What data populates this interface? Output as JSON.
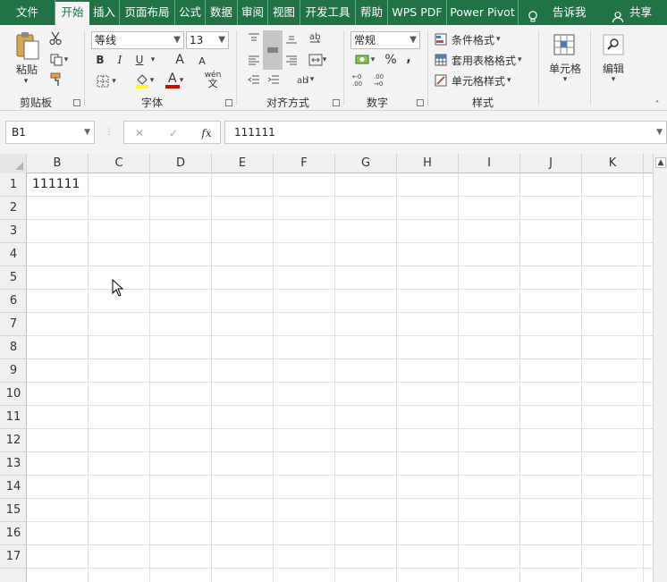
{
  "tabs": [
    "文件",
    "开始",
    "插入",
    "页面布局",
    "公式",
    "数据",
    "审阅",
    "视图",
    "开发工具",
    "帮助",
    "WPS PDF",
    "Power Pivot"
  ],
  "tell_me": "告诉我",
  "share": "共享",
  "ribbon": {
    "clipboard": {
      "paste": "粘贴",
      "group": "剪贴板"
    },
    "font": {
      "name": "等线",
      "size": "13",
      "group": "字体",
      "bold": "B",
      "italic": "I",
      "underline": "U",
      "grow": "A",
      "shrink": "A",
      "color_a": "A",
      "phonetic": "wén"
    },
    "align": {
      "group": "对齐方式"
    },
    "number": {
      "format": "常规",
      "percent": "%",
      "comma": ",",
      "group": "数字"
    },
    "styles": {
      "cond": "条件格式",
      "table": "套用表格格式",
      "cell": "单元格样式",
      "group": "样式"
    },
    "cells": {
      "label": "单元格"
    },
    "edit": {
      "label": "编辑"
    }
  },
  "formula_bar": {
    "name_box": "B1",
    "cancel": "✕",
    "enter": "✓",
    "fx": "fx",
    "content": "111111"
  },
  "grid": {
    "columns": [
      "B",
      "C",
      "D",
      "E",
      "F",
      "G",
      "H",
      "I",
      "J",
      "K"
    ],
    "rows": [
      "1",
      "2",
      "3",
      "4",
      "5",
      "6",
      "7",
      "8",
      "9",
      "10",
      "11",
      "12",
      "13",
      "14",
      "15",
      "16",
      "17"
    ],
    "cells": {
      "B1": "111111"
    }
  },
  "colors": {
    "accent": "#217346",
    "ribbon_bg": "#f3f3f3",
    "grid_line": "#e1e1e1"
  }
}
